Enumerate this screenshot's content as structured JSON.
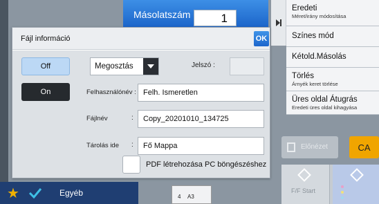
{
  "header": {
    "copies_label": "Másolatszám",
    "copies_value": "1"
  },
  "side_menu": [
    {
      "title": "Eredeti",
      "subtitle": "Méret/irány módosítása"
    },
    {
      "title": "Színes mód",
      "subtitle": ""
    },
    {
      "title": "Kétold.Másolás",
      "subtitle": ""
    },
    {
      "title": "Törlés",
      "subtitle": "Árnyék keret törlése"
    },
    {
      "title": "Üres oldal Átugrás",
      "subtitle": "Eredeti üres oldal kihagyása"
    }
  ],
  "actions": {
    "preview_label": "Előnézet",
    "ca_label": "CA",
    "start_label": "F/F Start"
  },
  "bottom_bar": {
    "other_label": "Egyéb",
    "copies_count": "4",
    "paper_size": "A3"
  },
  "dialog": {
    "title": "Fájl információ",
    "ok_label": "OK",
    "off_label": "Off",
    "on_label": "On",
    "share_select": "Megosztás",
    "password_label": "Jelszó :",
    "password_value": "",
    "user_name_label": "Felhasználónév :",
    "user_name_value": "Felh. Ismeretlen",
    "file_name_label": "Fájlnév",
    "file_name_value": "Copy_20201010_134725",
    "store_to_label": "Tárolás ide",
    "store_to_value": "Fő Mappa",
    "colon": ":",
    "pdf_checkbox_label": "PDF létrehozása PC böngészéshez",
    "pdf_checked": false
  },
  "colors": {
    "accent_blue": "#1d66cc",
    "toggle_selected": "#bcd8f5",
    "toggle_dark": "#262a2e",
    "ca_orange": "#f0a500",
    "bottom_bar": "#1f3e72"
  }
}
